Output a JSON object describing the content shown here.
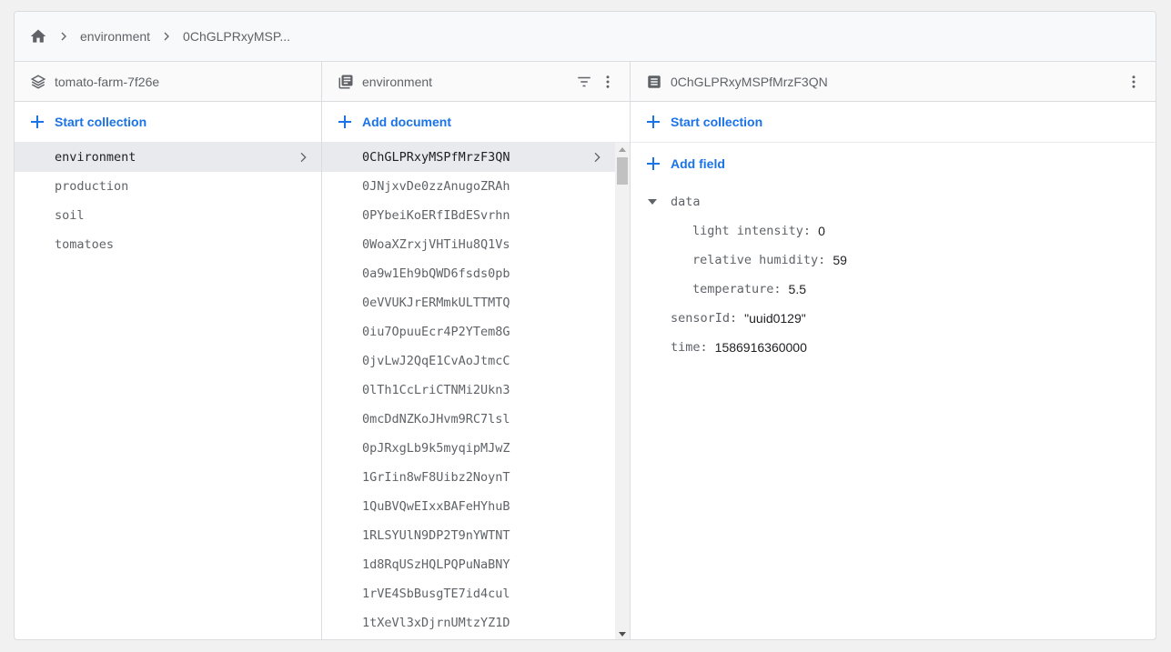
{
  "breadcrumb": {
    "home_icon": "home-icon",
    "items": [
      "environment",
      "0ChGLPRxyMSP..."
    ]
  },
  "colors": {
    "accent": "#1a73e8",
    "selected_bg": "#e8eaed",
    "text_muted": "#5f6368"
  },
  "panel_root": {
    "title": "tomato-farm-7f26e",
    "icon": "firestore-stack-icon",
    "action_label": "Start collection",
    "items": [
      "environment",
      "production",
      "soil",
      "tomatoes"
    ],
    "selected": "environment"
  },
  "panel_collection": {
    "title": "environment",
    "icon": "collection-icon",
    "action_label": "Add document",
    "items": [
      "0ChGLPRxyMSPfMrzF3QN",
      "0JNjxvDe0zzAnugoZRAh",
      "0PYbeiKoERfIBdESvrhn",
      "0WoaXZrxjVHTiHu8Q1Vs",
      "0a9w1Eh9bQWD6fsds0pb",
      "0eVVUKJrERMmkULTTMTQ",
      "0iu7OpuuEcr4P2YTem8G",
      "0jvLwJ2QqE1CvAoJtmcC",
      "0lTh1CcLriCTNMi2Ukn3",
      "0mcDdNZKoJHvm9RC7lsl",
      "0pJRxgLb9k5myqipMJwZ",
      "1GrIin8wF8Uibz2NoynT",
      "1QuBVQwEIxxBAFeHYhuB",
      "1RLSYUlN9DP2T9nYWTNT",
      "1d8RqUSzHQLPQPuNaBNY",
      "1rVE4SbBusgTE7id4cul",
      "1tXeVl3xDjrnUMtzYZ1D"
    ],
    "selected": "0ChGLPRxyMSPfMrzF3QN"
  },
  "panel_document": {
    "title": "0ChGLPRxyMSPfMrzF3QN",
    "icon": "document-icon",
    "action_label": "Start collection",
    "add_field_label": "Add field",
    "data_key": "data",
    "data_fields": [
      {
        "key": "light intensity",
        "value": "0"
      },
      {
        "key": "relative humidity",
        "value": "59"
      },
      {
        "key": "temperature",
        "value": "5.5"
      }
    ],
    "fields": [
      {
        "key": "sensorId",
        "value": "\"uuid0129\""
      },
      {
        "key": "time",
        "value": "1586916360000"
      }
    ]
  }
}
